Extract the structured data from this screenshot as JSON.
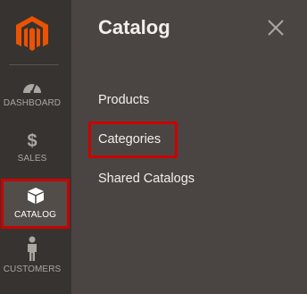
{
  "sidebar": {
    "logo_icon": "magento-logo-icon",
    "items": [
      {
        "id": "dashboard",
        "label": "DASHBOARD",
        "icon": "speedometer-icon",
        "active": false
      },
      {
        "id": "sales",
        "label": "SALES",
        "icon": "dollar-icon",
        "icon_glyph": "$",
        "active": false
      },
      {
        "id": "catalog",
        "label": "CATALOG",
        "icon": "box-icon",
        "active": true
      },
      {
        "id": "customers",
        "label": "CUSTOMERS",
        "icon": "person-icon",
        "active": false
      }
    ]
  },
  "flyout": {
    "title": "Catalog",
    "close_icon": "close-icon",
    "links": [
      {
        "label": "Products"
      },
      {
        "label": "Categories",
        "highlighted": true
      },
      {
        "label": "Shared Catalogs"
      }
    ]
  },
  "colors": {
    "sidebar_bg": "#373330",
    "flyout_bg": "#4a4542",
    "highlight": "#cc0000",
    "logo": "#eb5202",
    "text": "#f1efec"
  }
}
